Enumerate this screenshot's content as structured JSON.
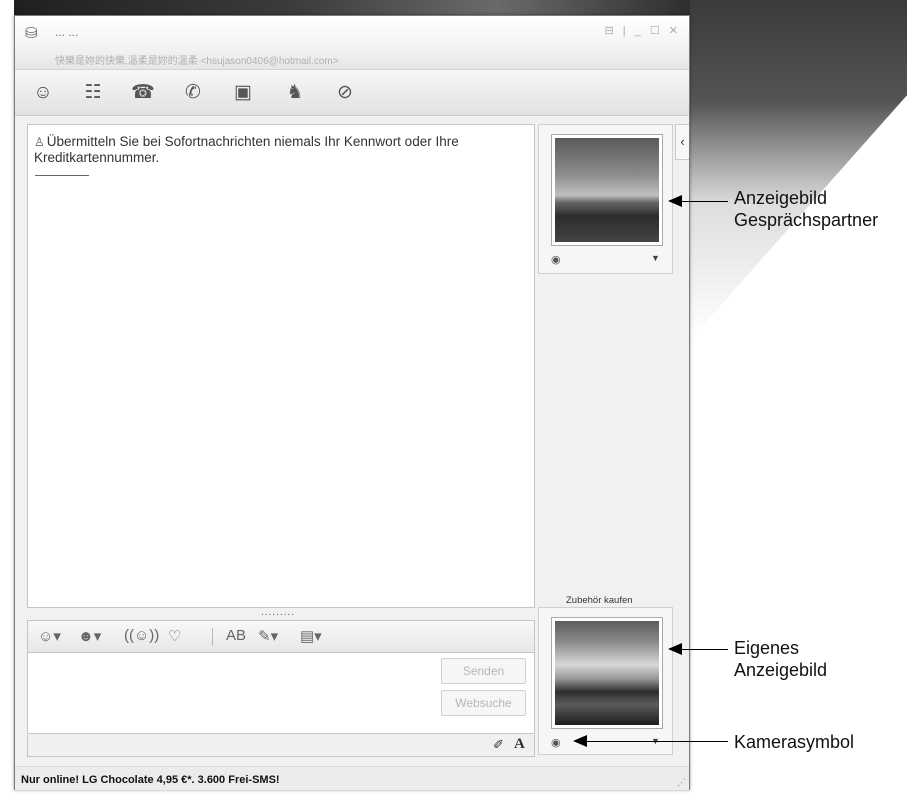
{
  "caption": "...y ... ... ... ... ... ... .. ... ... ...g ... ... ... ... ... ...",
  "window": {
    "contact_name": "... ...",
    "contact_subtitle": "快樂是妳的快樂,溫柔是妳的溫柔 <hsujason0406@hotmail.com>",
    "controls": "⊟ | _ ☐ ✕"
  },
  "toolbar_icons": [
    "add-contact-icon",
    "share-contacts-icon",
    "invite-icon",
    "call-icon",
    "video-icon",
    "games-icon",
    "block-icon"
  ],
  "conversation": {
    "notice": "Übermitteln Sie bei Sofortnachrichten niemals Ihr Kennwort oder Ihre Kreditkartennummer."
  },
  "input": {
    "send_label": "Senden",
    "search_label": "Websuche"
  },
  "side": {
    "accessories_link": "Zubehör kaufen"
  },
  "status_bar": {
    "ad_text": "Nur online! LG Chocolate 4,95 €*. 3.600 Frei-SMS!"
  },
  "annotations": {
    "contact_picture_line1": "Anzeigebild",
    "contact_picture_line2": "Gesprächspartner",
    "own_picture_line1": "Eigenes",
    "own_picture_line2": "Anzeigebild",
    "camera_symbol": "Kamerasymbol"
  }
}
